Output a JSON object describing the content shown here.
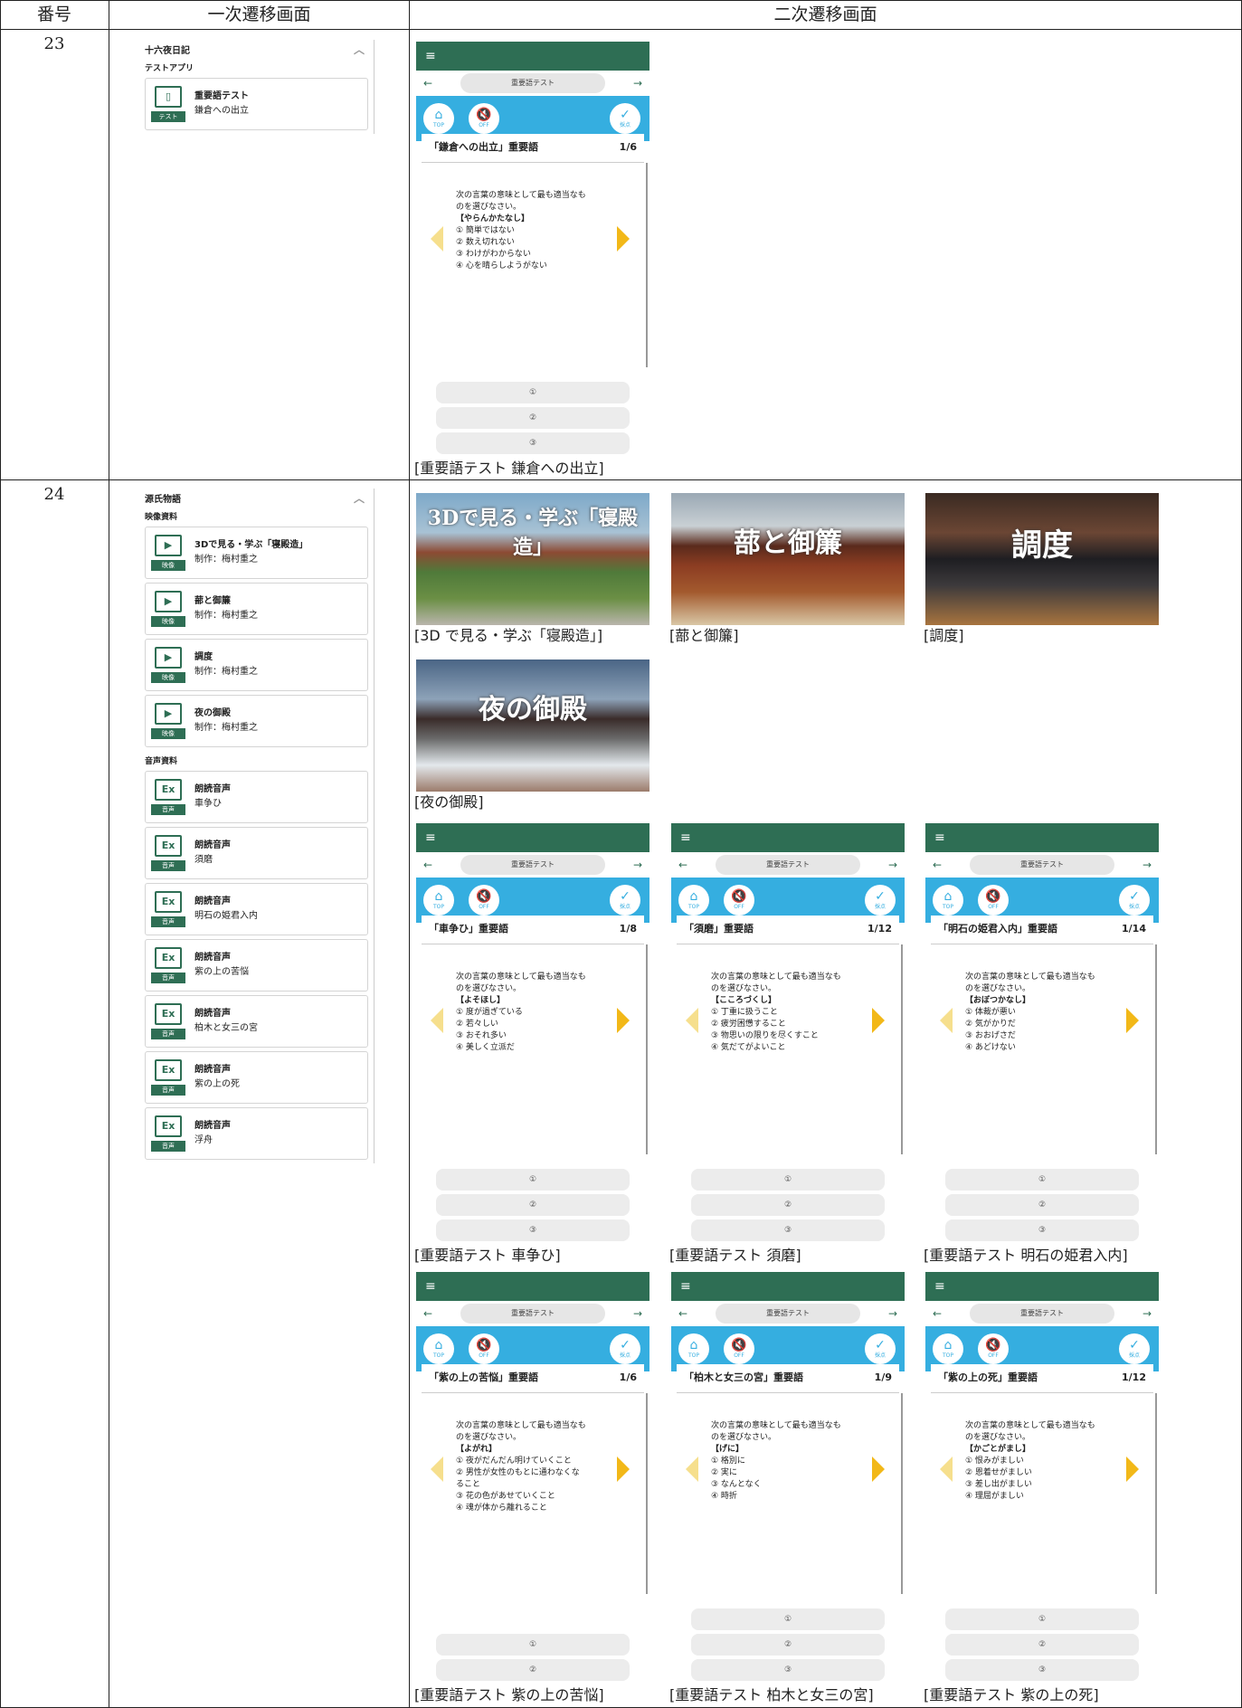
{
  "headers": {
    "num": "番号",
    "primary": "一次遷移画面",
    "secondary": "二次遷移画面"
  },
  "rows": [
    {
      "num": "23",
      "menu": {
        "title": "十六夜日記",
        "sections": [
          {
            "label": "テストアプリ",
            "items": [
              {
                "icon": "test",
                "tag": "テスト",
                "line1": "重要語テスト",
                "line2": "鎌倉への出立"
              }
            ]
          }
        ]
      },
      "phones": [
        {
          "pill": "重要語テスト",
          "title": "「鎌倉への出立」重要語",
          "page": "1/6",
          "question": [
            "次の言葉の意味として最も適当なも",
            "のを選びなさい。"
          ],
          "keyword": "【やらんかたなし】",
          "options": [
            "① 簡単ではない",
            "② 数え切れない",
            "③ わけがわからない",
            "④ 心を晴らしようがない"
          ],
          "answers": [
            "①",
            "②",
            "③"
          ],
          "caption": "[重要語テスト 鎌倉への出立]"
        }
      ]
    },
    {
      "num": "24",
      "menu": {
        "title": "源氏物語",
        "sections": [
          {
            "label": "映像資料",
            "items": [
              {
                "icon": "video",
                "tag": "映像",
                "line1": "3Dで見る・学ぶ「寝殿造」",
                "line2": "制作：梅村重之"
              },
              {
                "icon": "video",
                "tag": "映像",
                "line1": "蔀と御簾",
                "line2": "制作：梅村重之"
              },
              {
                "icon": "video",
                "tag": "映像",
                "line1": "調度",
                "line2": "制作：梅村重之"
              },
              {
                "icon": "video",
                "tag": "映像",
                "line1": "夜の御殿",
                "line2": "制作：梅村重之"
              }
            ]
          },
          {
            "label": "音声資料",
            "items": [
              {
                "icon": "audio",
                "tag": "音声",
                "line1": "朗読音声",
                "line2": "車争ひ"
              },
              {
                "icon": "audio",
                "tag": "音声",
                "line1": "朗読音声",
                "line2": "須磨"
              },
              {
                "icon": "audio",
                "tag": "音声",
                "line1": "朗読音声",
                "line2": "明石の姫君入内"
              },
              {
                "icon": "audio",
                "tag": "音声",
                "line1": "朗読音声",
                "line2": "紫の上の苦悩"
              },
              {
                "icon": "audio",
                "tag": "音声",
                "line1": "朗読音声",
                "line2": "柏木と女三の宮"
              },
              {
                "icon": "audio",
                "tag": "音声",
                "line1": "朗読音声",
                "line2": "紫の上の死"
              },
              {
                "icon": "audio",
                "tag": "音声",
                "line1": "朗読音声",
                "line2": "浮舟"
              }
            ]
          }
        ]
      },
      "videos": [
        {
          "overlay": "3Dで見る・学ぶ「寝殿造」",
          "caption": "[3D で見る・学ぶ「寝殿造」]"
        },
        {
          "overlay": "蔀と御簾",
          "caption": "[蔀と御簾]"
        },
        {
          "overlay": "調度",
          "caption": "[調度]"
        },
        {
          "overlay": "夜の御殿",
          "caption": "[夜の御殿]"
        }
      ],
      "phones": [
        {
          "pill": "重要語テスト",
          "title": "「車争ひ」重要語",
          "page": "1/8",
          "question": [
            "次の言葉の意味として最も適当なも",
            "のを選びなさい。"
          ],
          "keyword": "【よそほし】",
          "options": [
            "① 度が過ぎている",
            "② 若々しい",
            "③ おそれ多い",
            "④ 美しく立派だ"
          ],
          "answers": [
            "①",
            "②",
            "③"
          ],
          "caption": "[重要語テスト 車争ひ]"
        },
        {
          "pill": "重要語テスト",
          "title": "「須磨」重要語",
          "page": "1/12",
          "question": [
            "次の言葉の意味として最も適当なも",
            "のを選びなさい。"
          ],
          "keyword": "【こころづくし】",
          "options": [
            "① 丁重に扱うこと",
            "② 疲労困憊すること",
            "③ 物思いの限りを尽くすこと",
            "④ 気だてがよいこと"
          ],
          "answers": [
            "①",
            "②",
            "③"
          ],
          "caption": "[重要語テスト 須磨]"
        },
        {
          "pill": "重要語テスト",
          "title": "「明石の姫君入内」重要語",
          "page": "1/14",
          "question": [
            "次の言葉の意味として最も適当なも",
            "のを選びなさい。"
          ],
          "keyword": "【おぼつかなし】",
          "options": [
            "① 体裁が悪い",
            "② 気がかりだ",
            "③ おおげさだ",
            "④ あどけない"
          ],
          "answers": [
            "①",
            "②",
            "③"
          ],
          "caption": "[重要語テスト 明石の姫君入内]"
        },
        {
          "pill": "重要語テスト",
          "title": "「紫の上の苦悩」重要語",
          "page": "1/6",
          "question": [
            "次の言葉の意味として最も適当なも",
            "のを選びなさい。"
          ],
          "keyword": "【よがれ】",
          "options": [
            "① 夜がだんだん明けていくこと",
            "② 男性が女性のもとに通わなくな",
            "ること",
            "③ 花の色があせていくこと",
            "④ 魂が体から離れること"
          ],
          "answers": [
            "①",
            "②"
          ],
          "caption": "[重要語テスト 紫の上の苦悩]"
        },
        {
          "pill": "重要語テスト",
          "title": "「柏木と女三の宮」重要語",
          "page": "1/9",
          "question": [
            "次の言葉の意味として最も適当なも",
            "のを選びなさい。"
          ],
          "keyword": "【げに】",
          "options": [
            "① 格別に",
            "② 実に",
            "③ なんとなく",
            "④ 時折"
          ],
          "answers": [
            "①",
            "②",
            "③"
          ],
          "caption": "[重要語テスト 柏木と女三の宮]"
        },
        {
          "pill": "重要語テスト",
          "title": "「紫の上の死」重要語",
          "page": "1/12",
          "question": [
            "次の言葉の意味として最も適当なも",
            "のを選びなさい。"
          ],
          "keyword": "【かごとがまし】",
          "options": [
            "① 恨みがましい",
            "② 恩着せがましい",
            "③ 差し出がましい",
            "④ 理屈がましい"
          ],
          "answers": [
            "①",
            "②",
            "③"
          ],
          "caption": "[重要語テスト 紫の上の死]"
        }
      ]
    }
  ],
  "phone_ui": {
    "top_label": "TOP",
    "sound_label": "OFF",
    "check_label": "採点"
  }
}
